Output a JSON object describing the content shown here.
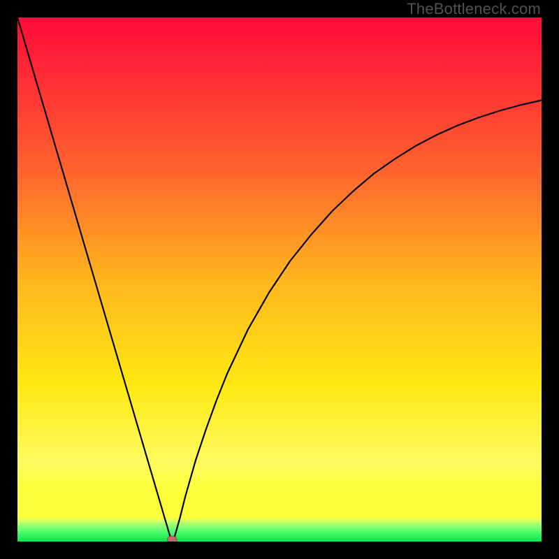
{
  "watermark": "TheBottleneck.com",
  "chart_data": {
    "type": "line",
    "title": "",
    "xlabel": "",
    "ylabel": "",
    "xlim": [
      0,
      100
    ],
    "ylim": [
      0,
      100
    ],
    "x": [
      0,
      2,
      4,
      6,
      8,
      10,
      12,
      14,
      16,
      18,
      20,
      22,
      24,
      26,
      28,
      29,
      29.5,
      30,
      31,
      32,
      34,
      36,
      38,
      40,
      44,
      48,
      52,
      56,
      60,
      64,
      68,
      72,
      76,
      80,
      84,
      88,
      92,
      96,
      100
    ],
    "values": [
      100,
      93.2,
      86.4,
      79.6,
      72.8,
      66.0,
      59.2,
      52.4,
      45.6,
      38.8,
      32.0,
      25.2,
      18.4,
      11.6,
      4.8,
      1.4,
      0.0,
      1.0,
      4.5,
      8.5,
      15.5,
      21.5,
      27.0,
      32.0,
      40.5,
      47.5,
      53.5,
      58.5,
      63.0,
      66.8,
      70.2,
      73.0,
      75.5,
      77.6,
      79.4,
      80.9,
      82.2,
      83.3,
      84.2
    ],
    "minimum_marker": {
      "x": 29.5,
      "y": 0.0
    },
    "gradient_colors": {
      "top": "#ff0a3a",
      "mid1": "#ff5f2f",
      "mid2": "#ffb51f",
      "mid3": "#ffe812",
      "lower": "#fffb60",
      "yellowband": "#fcff3a",
      "green": "#00e84a"
    }
  }
}
